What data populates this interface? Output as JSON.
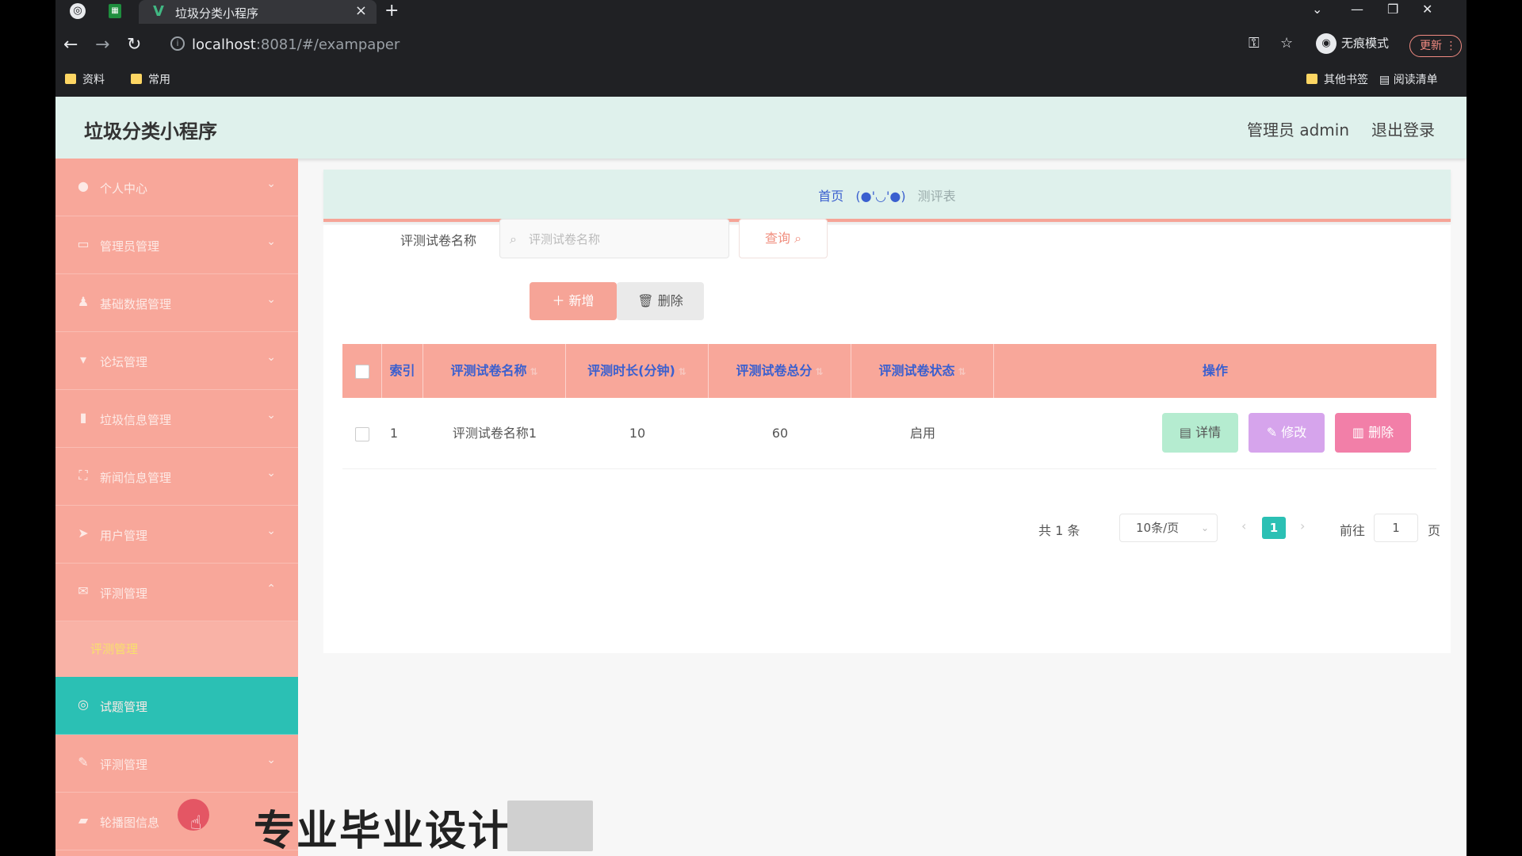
{
  "browser": {
    "tab_title": "垃圾分类小程序",
    "url_host": "localhost",
    "url_rest": ":8081/#/exampaper",
    "incognito_label": "无痕模式",
    "update_label": "更新",
    "bookmarks": [
      "资料",
      "常用"
    ],
    "bookmarks_right": [
      "其他书签",
      "阅读清单"
    ]
  },
  "header": {
    "title": "垃圾分类小程序",
    "admin_label": "管理员 admin",
    "logout_label": "退出登录"
  },
  "sidebar": {
    "items": [
      {
        "label": "个人中心",
        "icon": "user-icon"
      },
      {
        "label": "管理员管理",
        "icon": "id-card-icon"
      },
      {
        "label": "基础数据管理",
        "icon": "person-icon"
      },
      {
        "label": "论坛管理",
        "icon": "chat-icon"
      },
      {
        "label": "垃圾信息管理",
        "icon": "trash-icon"
      },
      {
        "label": "新闻信息管理",
        "icon": "news-icon"
      },
      {
        "label": "用户管理",
        "icon": "send-icon"
      },
      {
        "label": "评测管理",
        "icon": "mail-icon"
      },
      {
        "label": "试题管理",
        "icon": "globe-icon"
      },
      {
        "label": "评测管理",
        "icon": "edit-icon"
      },
      {
        "label": "轮播图信息",
        "icon": "image-icon"
      }
    ],
    "submenu_label": "评测管理"
  },
  "breadcrumb": {
    "home": "首页",
    "face": "(●'◡'●)",
    "current": "测评表"
  },
  "search": {
    "label": "评测试卷名称",
    "placeholder": "评测试卷名称",
    "query_label": "查询"
  },
  "actions": {
    "add_label": "新增",
    "delete_label": "删除"
  },
  "table": {
    "headers": [
      "索引",
      "评测试卷名称",
      "评测时长(分钟)",
      "评测试卷总分",
      "评测试卷状态",
      "操作"
    ],
    "rows": [
      {
        "index": "1",
        "name": "评测试卷名称1",
        "duration": "10",
        "total": "60",
        "status": "启用"
      }
    ],
    "op_detail": "详情",
    "op_edit": "修改",
    "op_delete": "删除"
  },
  "pagination": {
    "total": "共 1 条",
    "page_size": "10条/页",
    "current_page": "1",
    "goto_label": "前往",
    "goto_value": "1",
    "page_label": "页"
  },
  "overlay": {
    "watermark": "专业毕业设计"
  },
  "colors": {
    "sidebar": "#f8a79a",
    "active_menu": "#2bc0b4",
    "header": "#dff1ec",
    "accent_blue": "#3a5fcf"
  }
}
